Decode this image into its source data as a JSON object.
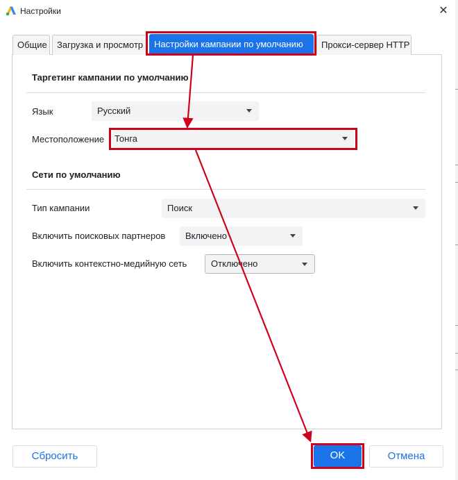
{
  "window": {
    "title": "Настройки",
    "close_glyph": "✕"
  },
  "tabs": [
    {
      "label": "Общие",
      "active": false
    },
    {
      "label": "Загрузка и просмотр",
      "active": false
    },
    {
      "label": "Настройки кампании по умолчанию",
      "active": true
    },
    {
      "label": "Прокси-сервер HTTP",
      "active": false
    }
  ],
  "targeting": {
    "section_title": "Таргетинг кампании по умолчанию",
    "language": {
      "label": "Язык",
      "value": "Русский"
    },
    "location": {
      "label": "Местоположение",
      "value": "Тонга"
    }
  },
  "networks": {
    "section_title": "Сети по умолчанию",
    "campaign_type": {
      "label": "Тип кампании",
      "value": "Поиск"
    },
    "search_partners": {
      "label": "Включить поисковых партнеров",
      "value": "Включено"
    },
    "display_network": {
      "label": "Включить контекстно-медийную сеть",
      "value": "Отключено"
    }
  },
  "footer": {
    "reset_label": "Сбросить",
    "ok_label": "OK",
    "cancel_label": "Отмена"
  },
  "colors": {
    "accent": "#1a73e8",
    "annotation": "#d0021b"
  }
}
